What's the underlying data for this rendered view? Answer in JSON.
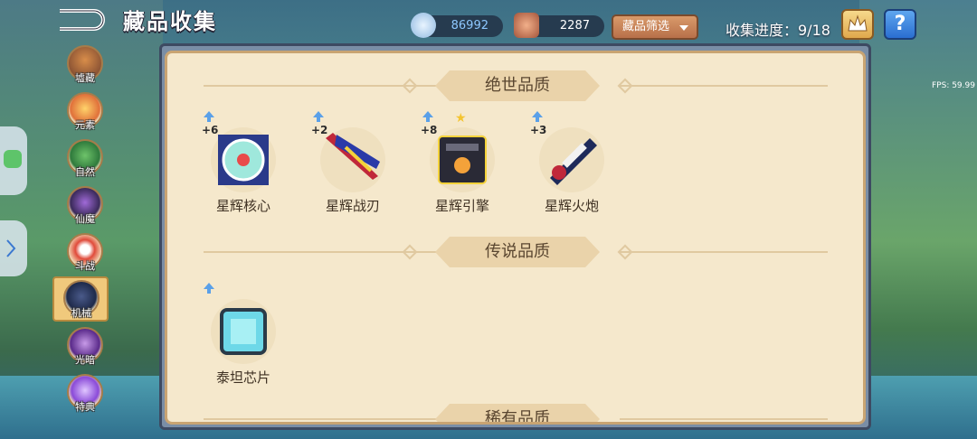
{
  "header": {
    "title": "藏品收集",
    "resources": [
      {
        "icon": "crystal-icon",
        "value": "86992"
      },
      {
        "icon": "ore-icon",
        "value": "2287"
      }
    ],
    "filter_label": "藏品筛选",
    "progress": "收集进度：9/18",
    "help_label": "?",
    "fps": "FPS: 59.99"
  },
  "categories": [
    {
      "label": "墟藏",
      "icon": "hero-icon",
      "active": false
    },
    {
      "label": "元素",
      "icon": "flame-icon",
      "active": false
    },
    {
      "label": "自然",
      "icon": "leaf-icon",
      "active": false
    },
    {
      "label": "仙魔",
      "icon": "demon-icon",
      "active": false
    },
    {
      "label": "斗战",
      "icon": "orb-icon",
      "active": false
    },
    {
      "label": "机械",
      "icon": "mech-icon",
      "active": true
    },
    {
      "label": "光暗",
      "icon": "shadow-icon",
      "active": false
    },
    {
      "label": "特典",
      "icon": "gem-icon",
      "active": false
    }
  ],
  "sections": [
    {
      "title": "绝世品质",
      "items": [
        {
          "name": "星辉核心",
          "level": "+6",
          "starred": false,
          "icon": "star-core-icon"
        },
        {
          "name": "星辉战刃",
          "level": "+2",
          "starred": false,
          "icon": "star-blade-icon"
        },
        {
          "name": "星辉引擎",
          "level": "+8",
          "starred": true,
          "icon": "star-engine-icon"
        },
        {
          "name": "星辉火炮",
          "level": "+3",
          "starred": false,
          "icon": "star-cannon-icon"
        }
      ]
    },
    {
      "title": "传说品质",
      "items": [
        {
          "name": "泰坦芯片",
          "level": "",
          "starred": false,
          "icon": "titan-chip-icon"
        }
      ]
    },
    {
      "title": "稀有品质",
      "items": []
    }
  ],
  "colors": {
    "panel": "#f5e8cc",
    "panel_border": "#c9a472",
    "accent": "#d99a6a"
  }
}
